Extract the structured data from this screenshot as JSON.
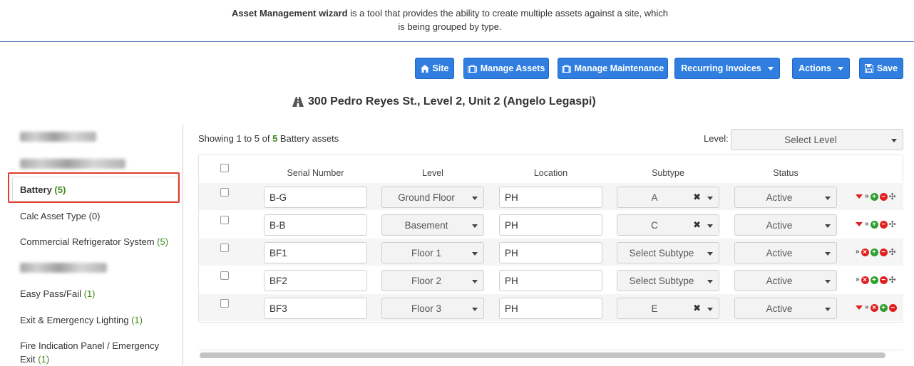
{
  "intro": {
    "bold": "Asset Management wizard",
    "line1_rest": " is a tool that provides the ability to create multiple assets against a site, which",
    "line2": "is being grouped by type."
  },
  "toolbar": {
    "site": "Site",
    "manage_assets": "Manage Assets",
    "manage_maintenance": "Manage Maintenance",
    "recurring_invoices": "Recurring Invoices",
    "actions": "Actions",
    "save": "Save"
  },
  "site_title": "300 Pedro Reyes St., Level 2, Unit 2 (Angelo Legaspi)",
  "sidebar": {
    "items": [
      {
        "label": "Battery",
        "count": "(5)"
      },
      {
        "label": "Calc Asset Type",
        "count": "(0)"
      },
      {
        "label": "Commercial Refrigerator System",
        "count": "(5)"
      },
      {
        "label": "Easy Pass/Fail",
        "count": "(1)"
      },
      {
        "label": "Exit & Emergency Lighting",
        "count": "(1)"
      },
      {
        "label": "Fire Indication Panel / Emergency",
        "label2": "Exit",
        "count": "(1)"
      }
    ]
  },
  "summary": {
    "prefix": "Showing 1 to 5 of ",
    "total": "5",
    "suffix": " Battery assets"
  },
  "level_filter": {
    "label": "Level:",
    "value": "Select Level"
  },
  "table": {
    "headers": [
      "Serial Number",
      "Level",
      "Location",
      "Subtype",
      "Status"
    ],
    "rows": [
      {
        "serial": "B-G",
        "level": "Ground Floor",
        "location": "PH",
        "subtype": "A",
        "status": "Active"
      },
      {
        "serial": "B-B",
        "level": "Basement",
        "location": "PH",
        "subtype": "C",
        "status": "Active"
      },
      {
        "serial": "BF1",
        "level": "Floor 1",
        "location": "PH",
        "subtype": "Select Subtype",
        "status": "Active"
      },
      {
        "serial": "BF2",
        "level": "Floor 2",
        "location": "PH",
        "subtype": "Select Subtype",
        "status": "Active"
      },
      {
        "serial": "BF3",
        "level": "Floor 3",
        "location": "PH",
        "subtype": "E",
        "status": "Active"
      }
    ]
  },
  "colors": {
    "primary": "#2f7ee0",
    "count_green": "#3c8a1a",
    "highlight": "#e53b2c"
  }
}
